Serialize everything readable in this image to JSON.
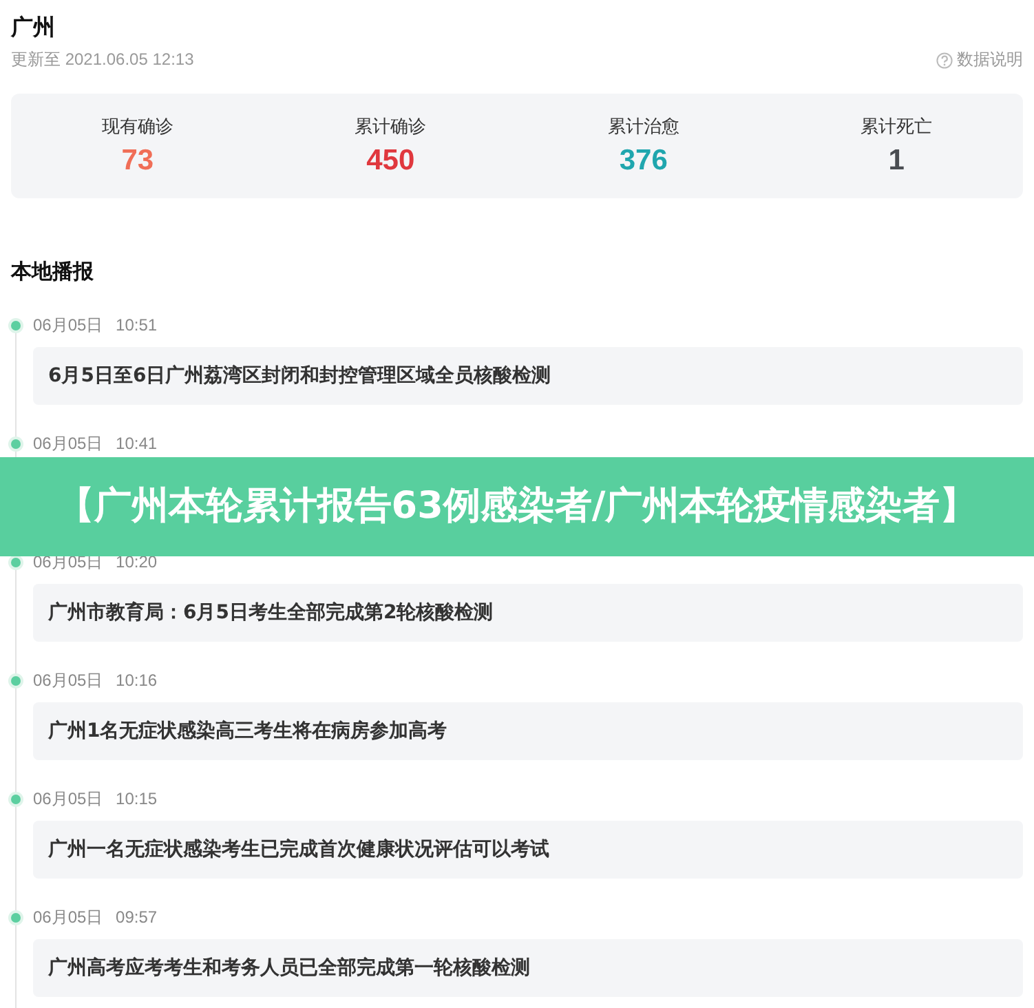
{
  "header": {
    "title": "广州",
    "updated": "更新至 2021.06.05 12:13",
    "help_link": "数据说明"
  },
  "stats": [
    {
      "label": "现有确诊",
      "value": "73",
      "color": "#f06e57"
    },
    {
      "label": "累计确诊",
      "value": "450",
      "color": "#e0383e"
    },
    {
      "label": "累计治愈",
      "value": "376",
      "color": "#1fa6ae"
    },
    {
      "label": "累计死亡",
      "value": "1",
      "color": "#4a4d52"
    }
  ],
  "section_title": "本地播报",
  "news": [
    {
      "date": "06月05日",
      "time": "10:51",
      "title": "6月5日至6日广州荔湾区封闭和封控管理区域全员核酸检测"
    },
    {
      "date": "06月05日",
      "time": "10:41"
    },
    {
      "date": "06月05日",
      "time": "10:20",
      "title": "广州市教育局：6月5日考生全部完成第2轮核酸检测"
    },
    {
      "date": "06月05日",
      "time": "10:16",
      "title": "广州1名无症状感染高三考生将在病房参加高考"
    },
    {
      "date": "06月05日",
      "time": "10:15",
      "title": "广州一名无症状感染考生已完成首次健康状况评估可以考试"
    },
    {
      "date": "06月05日",
      "time": "09:57",
      "title": "广州高考应考考生和考务人员已全部完成第一轮核酸检测"
    }
  ],
  "banner": {
    "text": "【广州本轮累计报告63例感染者/广州本轮疫情感染者】"
  }
}
